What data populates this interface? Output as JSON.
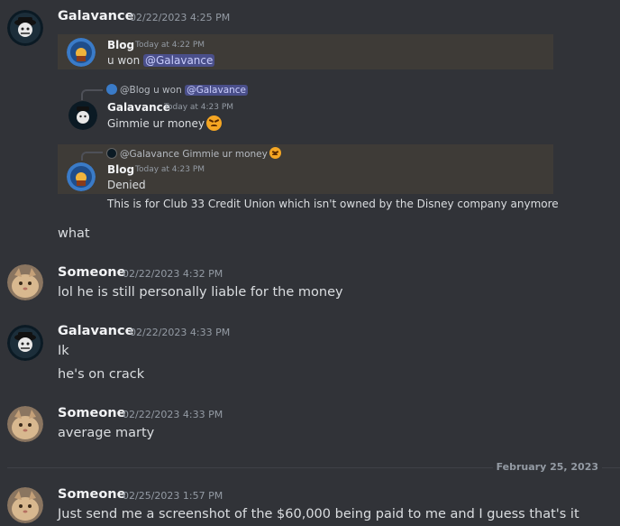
{
  "messages": [
    {
      "user": "Galavance",
      "time": "02/22/2023 4:25 PM",
      "embed1": {
        "user": "Blog",
        "time": "Today at 4:22 PM",
        "text": "u won ",
        "mention": "@Galavance"
      },
      "embed2": {
        "reply_user": "@Blog",
        "reply_text": "u won ",
        "reply_mention": "@Galavance",
        "user": "Galavance",
        "time": "Today at 4:23 PM",
        "text": "Gimmie ur money"
      },
      "embed3": {
        "reply_user": "@Galavance",
        "reply_text": "Gimmie ur money",
        "user": "Blog",
        "time": "Today at 4:23 PM",
        "text": "Denied"
      },
      "caption": "This is for Club 33 Credit Union which isn't owned by the Disney company anymore",
      "followup": "what"
    },
    {
      "user": "Someone",
      "time": "02/22/2023 4:32 PM",
      "text": "lol he is still personally liable for the money"
    },
    {
      "user": "Galavance",
      "time": "02/22/2023 4:33 PM",
      "text": "Ik",
      "followup": "he's on crack"
    },
    {
      "user": "Someone",
      "time": "02/22/2023 4:33 PM",
      "text": "average marty"
    },
    {
      "user": "Someone",
      "time": "02/25/2023 1:57 PM",
      "text": "Just send me a screenshot of the $60,000 being paid to me and I guess that's it"
    }
  ],
  "divider": "February 25, 2023",
  "colors": {
    "background": "#313338",
    "embed": "#3e3b37",
    "mention_bg": "#4a4f8a",
    "mention_text": "#c9cdfb"
  }
}
